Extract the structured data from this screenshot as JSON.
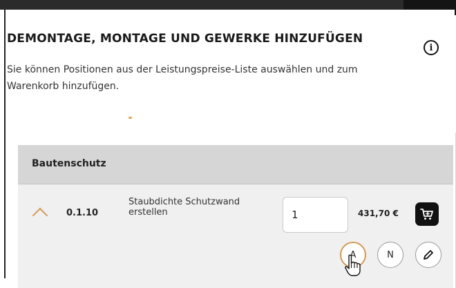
{
  "header": {
    "title": "DEMONTAGE, MONTAGE UND GEWERKE HINZUFÜGEN",
    "subtitle": "Sie können Positionen aus der Leistungspreise-Liste auswählen und zum Warenkorb hinzufügen.",
    "info_icon": "info-circle-icon"
  },
  "table": {
    "category": "Bautenschutz",
    "row": {
      "position_number": "0.1.10",
      "description": "Staubdichte Schutzwand erstellen",
      "quantity": "1",
      "price": "431,70 €",
      "actions": {
        "a_label": "A",
        "n_label": "N"
      }
    }
  },
  "colors": {
    "accent": "#d39a57",
    "header_bg": "#d6d6d6",
    "row_bg": "#f0f0f0",
    "cart_button": "#111111"
  },
  "icons": [
    "info-circle-icon",
    "chevron-up-icon",
    "cart-icon",
    "pencil-icon",
    "hand-cursor-icon"
  ]
}
